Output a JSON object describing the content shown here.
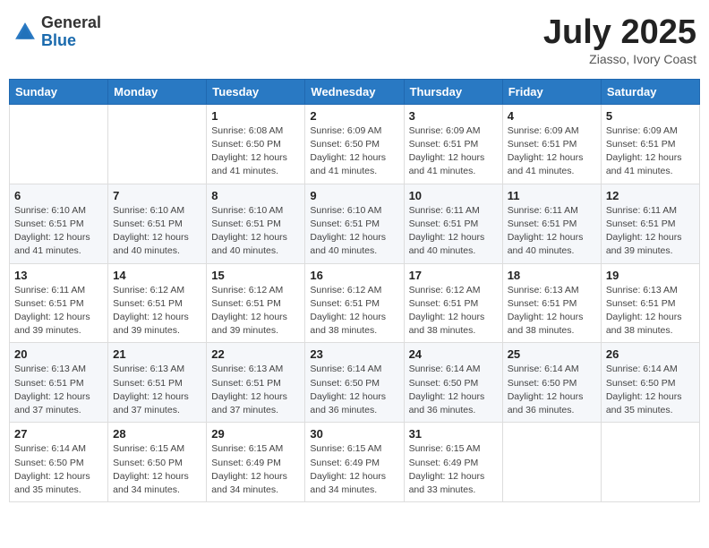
{
  "header": {
    "logo_general": "General",
    "logo_blue": "Blue",
    "month_title": "July 2025",
    "subtitle": "Ziasso, Ivory Coast"
  },
  "calendar": {
    "days_of_week": [
      "Sunday",
      "Monday",
      "Tuesday",
      "Wednesday",
      "Thursday",
      "Friday",
      "Saturday"
    ],
    "weeks": [
      [
        {
          "day": "",
          "sunrise": "",
          "sunset": "",
          "daylight": ""
        },
        {
          "day": "",
          "sunrise": "",
          "sunset": "",
          "daylight": ""
        },
        {
          "day": "1",
          "sunrise": "Sunrise: 6:08 AM",
          "sunset": "Sunset: 6:50 PM",
          "daylight": "Daylight: 12 hours and 41 minutes."
        },
        {
          "day": "2",
          "sunrise": "Sunrise: 6:09 AM",
          "sunset": "Sunset: 6:50 PM",
          "daylight": "Daylight: 12 hours and 41 minutes."
        },
        {
          "day": "3",
          "sunrise": "Sunrise: 6:09 AM",
          "sunset": "Sunset: 6:51 PM",
          "daylight": "Daylight: 12 hours and 41 minutes."
        },
        {
          "day": "4",
          "sunrise": "Sunrise: 6:09 AM",
          "sunset": "Sunset: 6:51 PM",
          "daylight": "Daylight: 12 hours and 41 minutes."
        },
        {
          "day": "5",
          "sunrise": "Sunrise: 6:09 AM",
          "sunset": "Sunset: 6:51 PM",
          "daylight": "Daylight: 12 hours and 41 minutes."
        }
      ],
      [
        {
          "day": "6",
          "sunrise": "Sunrise: 6:10 AM",
          "sunset": "Sunset: 6:51 PM",
          "daylight": "Daylight: 12 hours and 41 minutes."
        },
        {
          "day": "7",
          "sunrise": "Sunrise: 6:10 AM",
          "sunset": "Sunset: 6:51 PM",
          "daylight": "Daylight: 12 hours and 40 minutes."
        },
        {
          "day": "8",
          "sunrise": "Sunrise: 6:10 AM",
          "sunset": "Sunset: 6:51 PM",
          "daylight": "Daylight: 12 hours and 40 minutes."
        },
        {
          "day": "9",
          "sunrise": "Sunrise: 6:10 AM",
          "sunset": "Sunset: 6:51 PM",
          "daylight": "Daylight: 12 hours and 40 minutes."
        },
        {
          "day": "10",
          "sunrise": "Sunrise: 6:11 AM",
          "sunset": "Sunset: 6:51 PM",
          "daylight": "Daylight: 12 hours and 40 minutes."
        },
        {
          "day": "11",
          "sunrise": "Sunrise: 6:11 AM",
          "sunset": "Sunset: 6:51 PM",
          "daylight": "Daylight: 12 hours and 40 minutes."
        },
        {
          "day": "12",
          "sunrise": "Sunrise: 6:11 AM",
          "sunset": "Sunset: 6:51 PM",
          "daylight": "Daylight: 12 hours and 39 minutes."
        }
      ],
      [
        {
          "day": "13",
          "sunrise": "Sunrise: 6:11 AM",
          "sunset": "Sunset: 6:51 PM",
          "daylight": "Daylight: 12 hours and 39 minutes."
        },
        {
          "day": "14",
          "sunrise": "Sunrise: 6:12 AM",
          "sunset": "Sunset: 6:51 PM",
          "daylight": "Daylight: 12 hours and 39 minutes."
        },
        {
          "day": "15",
          "sunrise": "Sunrise: 6:12 AM",
          "sunset": "Sunset: 6:51 PM",
          "daylight": "Daylight: 12 hours and 39 minutes."
        },
        {
          "day": "16",
          "sunrise": "Sunrise: 6:12 AM",
          "sunset": "Sunset: 6:51 PM",
          "daylight": "Daylight: 12 hours and 38 minutes."
        },
        {
          "day": "17",
          "sunrise": "Sunrise: 6:12 AM",
          "sunset": "Sunset: 6:51 PM",
          "daylight": "Daylight: 12 hours and 38 minutes."
        },
        {
          "day": "18",
          "sunrise": "Sunrise: 6:13 AM",
          "sunset": "Sunset: 6:51 PM",
          "daylight": "Daylight: 12 hours and 38 minutes."
        },
        {
          "day": "19",
          "sunrise": "Sunrise: 6:13 AM",
          "sunset": "Sunset: 6:51 PM",
          "daylight": "Daylight: 12 hours and 38 minutes."
        }
      ],
      [
        {
          "day": "20",
          "sunrise": "Sunrise: 6:13 AM",
          "sunset": "Sunset: 6:51 PM",
          "daylight": "Daylight: 12 hours and 37 minutes."
        },
        {
          "day": "21",
          "sunrise": "Sunrise: 6:13 AM",
          "sunset": "Sunset: 6:51 PM",
          "daylight": "Daylight: 12 hours and 37 minutes."
        },
        {
          "day": "22",
          "sunrise": "Sunrise: 6:13 AM",
          "sunset": "Sunset: 6:51 PM",
          "daylight": "Daylight: 12 hours and 37 minutes."
        },
        {
          "day": "23",
          "sunrise": "Sunrise: 6:14 AM",
          "sunset": "Sunset: 6:50 PM",
          "daylight": "Daylight: 12 hours and 36 minutes."
        },
        {
          "day": "24",
          "sunrise": "Sunrise: 6:14 AM",
          "sunset": "Sunset: 6:50 PM",
          "daylight": "Daylight: 12 hours and 36 minutes."
        },
        {
          "day": "25",
          "sunrise": "Sunrise: 6:14 AM",
          "sunset": "Sunset: 6:50 PM",
          "daylight": "Daylight: 12 hours and 36 minutes."
        },
        {
          "day": "26",
          "sunrise": "Sunrise: 6:14 AM",
          "sunset": "Sunset: 6:50 PM",
          "daylight": "Daylight: 12 hours and 35 minutes."
        }
      ],
      [
        {
          "day": "27",
          "sunrise": "Sunrise: 6:14 AM",
          "sunset": "Sunset: 6:50 PM",
          "daylight": "Daylight: 12 hours and 35 minutes."
        },
        {
          "day": "28",
          "sunrise": "Sunrise: 6:15 AM",
          "sunset": "Sunset: 6:50 PM",
          "daylight": "Daylight: 12 hours and 34 minutes."
        },
        {
          "day": "29",
          "sunrise": "Sunrise: 6:15 AM",
          "sunset": "Sunset: 6:49 PM",
          "daylight": "Daylight: 12 hours and 34 minutes."
        },
        {
          "day": "30",
          "sunrise": "Sunrise: 6:15 AM",
          "sunset": "Sunset: 6:49 PM",
          "daylight": "Daylight: 12 hours and 34 minutes."
        },
        {
          "day": "31",
          "sunrise": "Sunrise: 6:15 AM",
          "sunset": "Sunset: 6:49 PM",
          "daylight": "Daylight: 12 hours and 33 minutes."
        },
        {
          "day": "",
          "sunrise": "",
          "sunset": "",
          "daylight": ""
        },
        {
          "day": "",
          "sunrise": "",
          "sunset": "",
          "daylight": ""
        }
      ]
    ]
  }
}
